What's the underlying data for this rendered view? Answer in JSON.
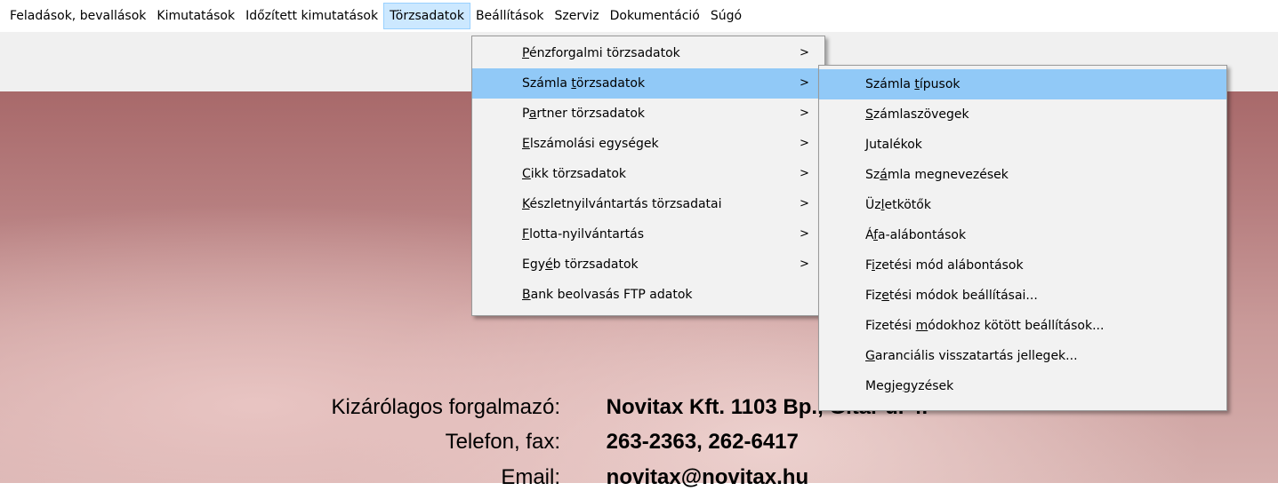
{
  "menubar": {
    "items": [
      {
        "label": "Feladások, bevallások"
      },
      {
        "label": "Kimutatások"
      },
      {
        "label": "Időzített kimutatások"
      },
      {
        "label": "Törzsadatok"
      },
      {
        "label": "Beállítások"
      },
      {
        "label": "Szerviz"
      },
      {
        "label": "Dokumentáció"
      },
      {
        "label": "Súgó"
      }
    ]
  },
  "torzsadatok_menu": {
    "items": [
      {
        "pre": "",
        "u": "P",
        "post": "énzforgalmi törzsadatok"
      },
      {
        "pre": "Számla ",
        "u": "t",
        "post": "örzsadatok"
      },
      {
        "pre": "P",
        "u": "a",
        "post": "rtner törzsadatok"
      },
      {
        "pre": "",
        "u": "E",
        "post": "lszámolási egységek"
      },
      {
        "pre": "",
        "u": "C",
        "post": "ikk törzsadatok"
      },
      {
        "pre": "",
        "u": "K",
        "post": "észletnyilvántartás törzsadatai"
      },
      {
        "pre": "",
        "u": "F",
        "post": "lotta-nyilvántartás"
      },
      {
        "pre": "Egy",
        "u": "é",
        "post": "b törzsadatok"
      },
      {
        "pre": "",
        "u": "B",
        "post": "ank beolvasás FTP adatok"
      }
    ],
    "arrow": ">"
  },
  "szamla_submenu": {
    "items": [
      {
        "pre": "Számla ",
        "u": "t",
        "post": "ípusok"
      },
      {
        "pre": "",
        "u": "S",
        "post": "zámlaszövegek"
      },
      {
        "pre": "",
        "u": "J",
        "post": "utalékok"
      },
      {
        "pre": "Sz",
        "u": "á",
        "post": "mla megnevezések"
      },
      {
        "pre": "Üz",
        "u": "l",
        "post": "etkötők"
      },
      {
        "pre": "Á",
        "u": "f",
        "post": "a-alábontások"
      },
      {
        "pre": "F",
        "u": "i",
        "post": "zetési mód alábontások"
      },
      {
        "pre": "Fiz",
        "u": "e",
        "post": "tési módok beállításai..."
      },
      {
        "pre": "Fizetési ",
        "u": "m",
        "post": "ódokhoz kötött beállítások..."
      },
      {
        "pre": "",
        "u": "G",
        "post": "aranciális visszatartás jellegek..."
      },
      {
        "pre": "Megje",
        "u": "g",
        "post": "yzések"
      }
    ]
  },
  "splash": {
    "rows": [
      {
        "label": "Kizárólagos forgalmazó:",
        "value": "Novitax Kft.   1103 Bp., Gitár u. 4."
      },
      {
        "label": "Telefon, fax:",
        "value": "263-2363, 262-6417"
      },
      {
        "label": "Email:",
        "value": "novitax@novitax.hu"
      }
    ]
  }
}
